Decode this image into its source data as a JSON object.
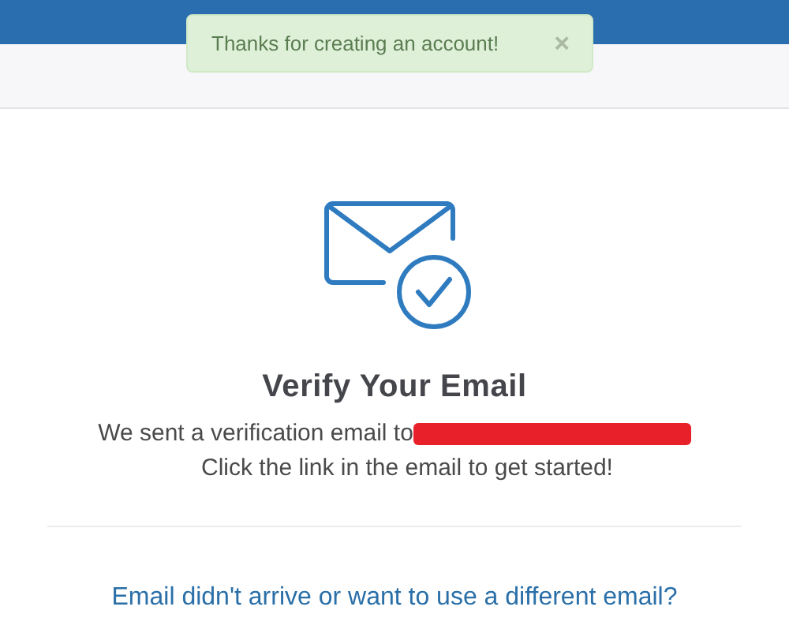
{
  "toast": {
    "message": "Thanks for creating an account!",
    "close": "×"
  },
  "verify": {
    "title": "Verify Your Email",
    "sent_text": "We sent a verification email to",
    "recipient": {
      "redacted": true
    },
    "instruction": "Click the link in the email to get started!",
    "help_link": "Email didn't arrive or want to use a different email?"
  }
}
